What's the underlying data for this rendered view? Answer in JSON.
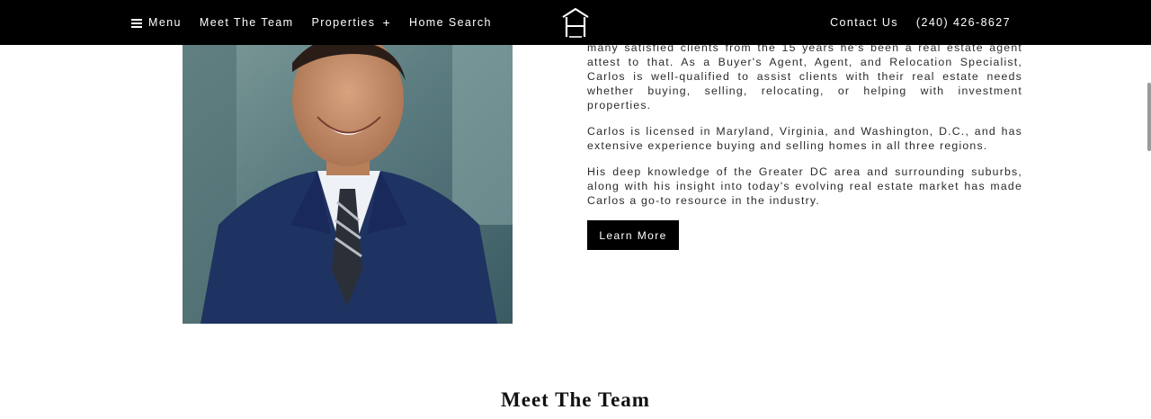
{
  "header": {
    "menu_label": "Menu",
    "nav_left": [
      {
        "label": "Meet The Team"
      },
      {
        "label": "Properties"
      },
      {
        "label": "Home Search"
      }
    ],
    "properties_symbol": "+",
    "contact_label": "Contact Us",
    "phone": "(240) 426-8627",
    "logo_icon": "house-logo-icon"
  },
  "bio": {
    "paragraphs": [
      "many satisfied clients from the 15 years he's been a real estate agent attest to that. As a Buyer's Agent, Agent, and Relocation Specialist, Carlos is well-qualified to assist clients with their real estate needs whether buying, selling, relocating, or helping with investment properties.",
      "Carlos is licensed in Maryland, Virginia, and Washington, D.C., and has extensive experience buying and selling homes in all three regions.",
      "His deep knowledge of the Greater DC area and surrounding suburbs, along with his insight into today's evolving real estate market has made Carlos a go-to resource in the industry."
    ],
    "button_label": "Learn More"
  },
  "section": {
    "title": "Meet The Team"
  },
  "colors": {
    "header_bg": "#000000",
    "button_bg": "#000000",
    "text": "#2a2a2a"
  }
}
